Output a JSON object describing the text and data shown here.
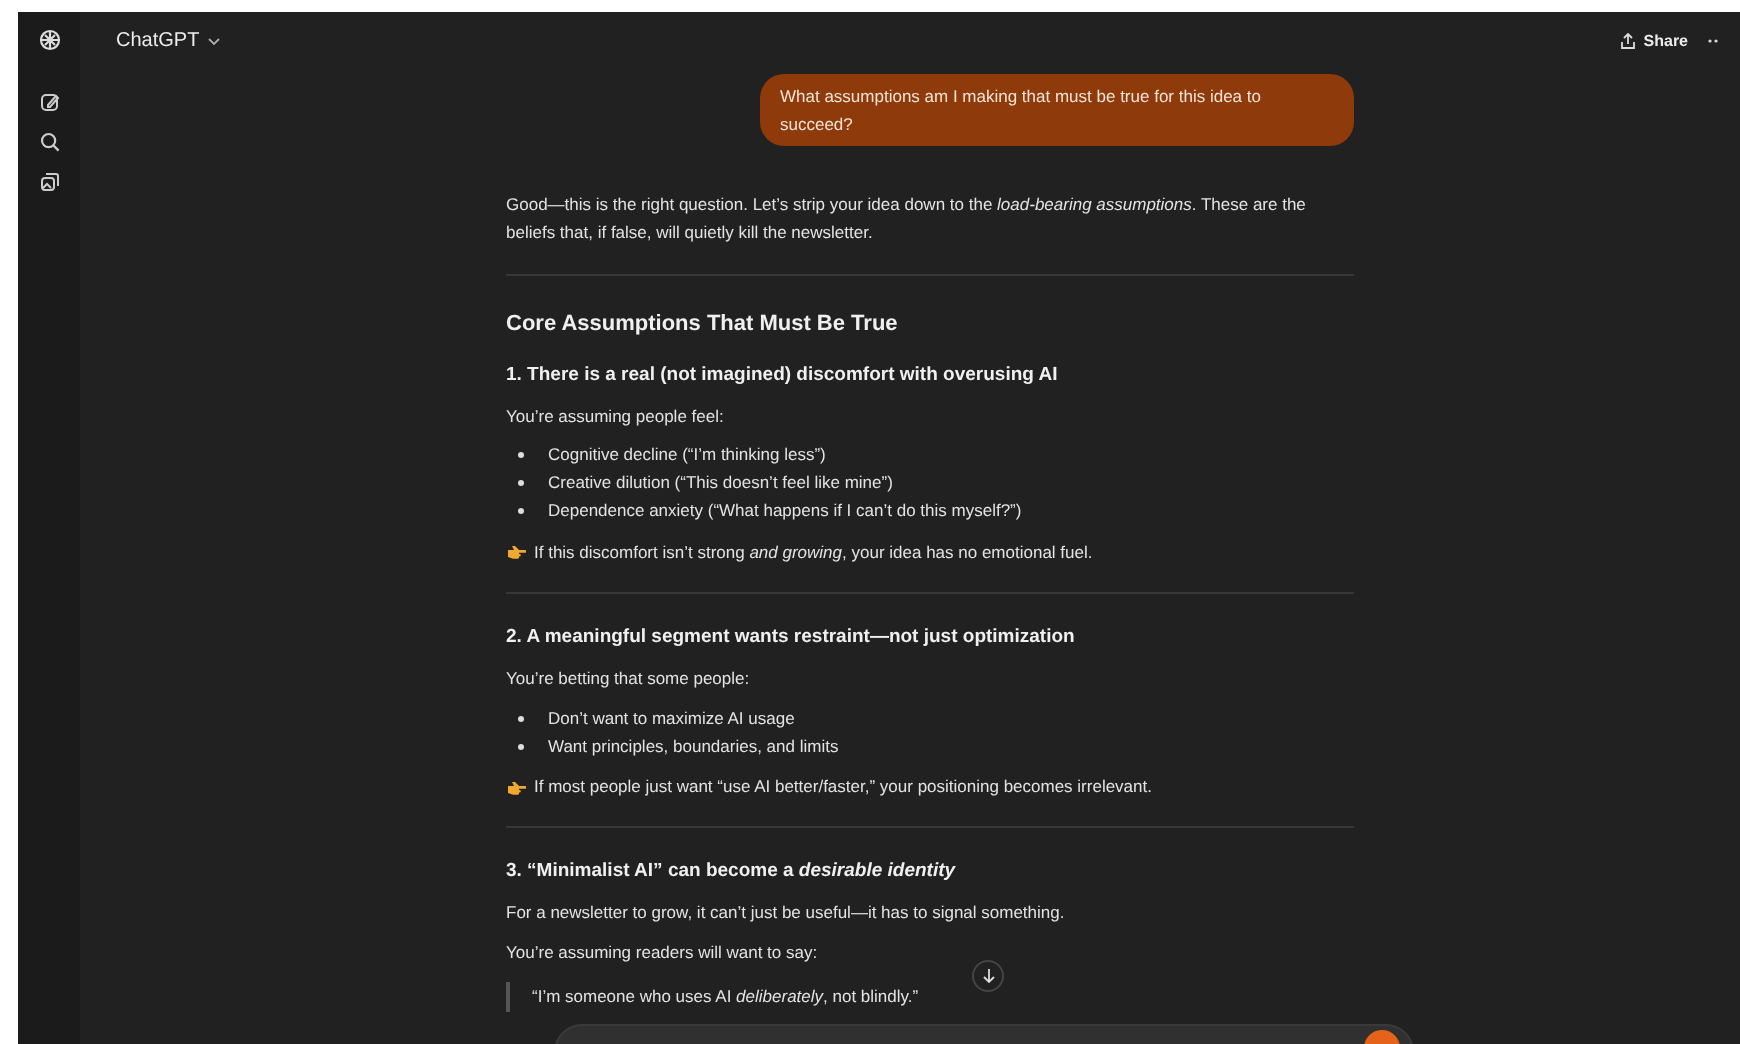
{
  "header": {
    "title": "ChatGPT",
    "share": "Share"
  },
  "user_message": "What assumptions am I making that must be true for this idea to succeed?",
  "response": [
    {
      "kind": "paragraph",
      "text": "Good—this is the right question. Let’s strip your idea down to the *load-bearing assumptions*. These are the beliefs that, if false, will quietly kill the newsletter."
    },
    {
      "kind": "divider"
    },
    {
      "kind": "h2",
      "text": "Core Assumptions That Must Be True"
    },
    {
      "kind": "h3",
      "text": "1. There is a real (not imagined) discomfort with overusing AI"
    },
    {
      "kind": "paragraph",
      "text": "You’re assuming people feel:"
    },
    {
      "kind": "list",
      "items": [
        "Cognitive decline (“I’m thinking less”)",
        "Creative dilution (“This doesn’t feel like mine”)",
        "Dependence anxiety (“What happens if I can’t do this myself?”)"
      ]
    },
    {
      "kind": "note",
      "text": "If this discomfort isn’t strong *and growing*, your idea has no emotional fuel."
    },
    {
      "kind": "divider"
    },
    {
      "kind": "h3",
      "text": "2. A meaningful segment wants restraint—not just optimization"
    },
    {
      "kind": "paragraph",
      "text": "You’re betting that some people:"
    },
    {
      "kind": "list",
      "items": [
        "Don’t want to maximize AI usage",
        "Want principles, boundaries, and limits"
      ]
    },
    {
      "kind": "note",
      "text": "If most people just want “use AI better/faster,” your positioning becomes irrelevant."
    },
    {
      "kind": "divider"
    },
    {
      "kind": "h3",
      "text": "3. “Minimalist AI” can become a *desirable identity*"
    },
    {
      "kind": "paragraph",
      "text": "For a newsletter to grow, it can’t just be useful—it has to signal something."
    },
    {
      "kind": "paragraph",
      "text": "You’re assuming readers will want to say:"
    },
    {
      "kind": "quote",
      "text": "“I’m someone who uses AI *deliberately*, not blindly.”"
    }
  ]
}
